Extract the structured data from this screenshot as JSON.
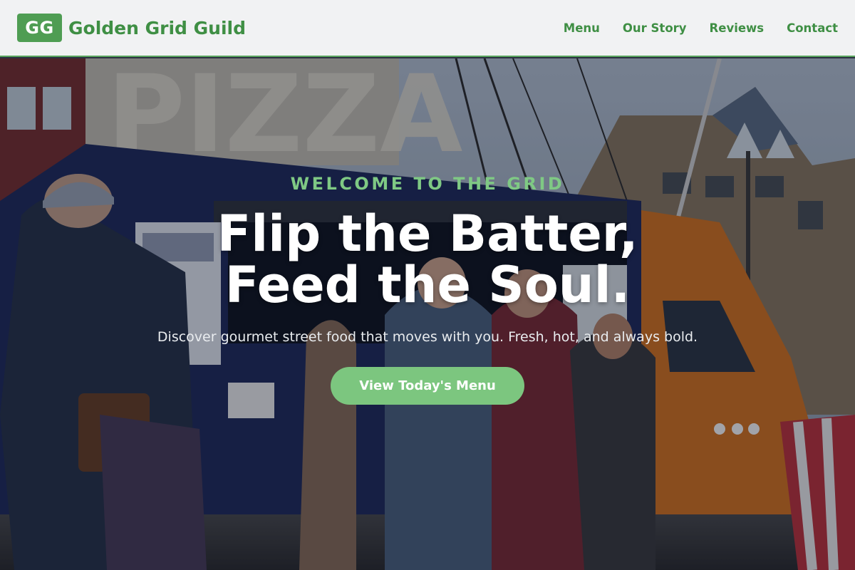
{
  "brand": {
    "logo_text": "GG",
    "name": "Golden Grid Guild",
    "accent_color": "#4f9d53"
  },
  "nav": {
    "items": [
      "Menu",
      "Our Story",
      "Reviews",
      "Contact"
    ]
  },
  "hero": {
    "eyebrow": "WELCOME TO THE GRID",
    "headline_line1": "Flip the Batter,",
    "headline_line2": "Feed the Soul.",
    "subtitle": "Discover gourmet street food that moves with you. Fresh, hot, and always bold.",
    "cta_label": "View Today's Menu",
    "background_image": "food-truck-crowd-photo",
    "sign_text": "PIZZA"
  }
}
